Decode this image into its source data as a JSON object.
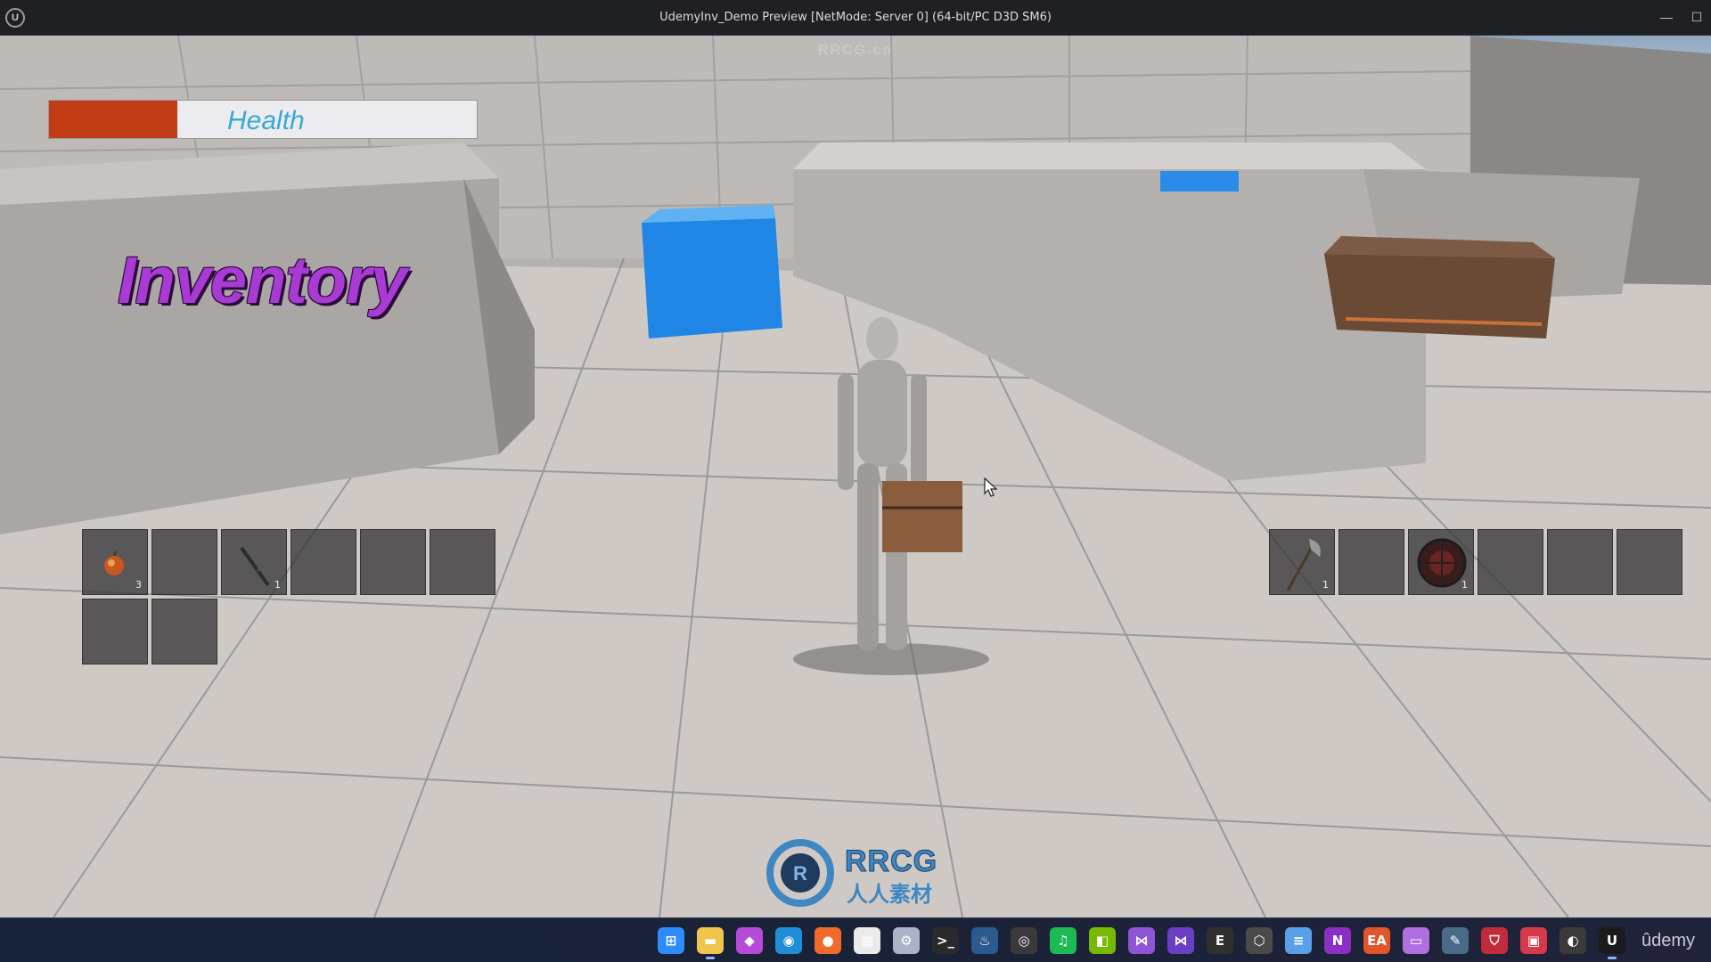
{
  "window": {
    "title": "UdemyInv_Demo Preview [NetMode: Server 0]  (64-bit/PC D3D SM6)",
    "app_icon_glyph": "U",
    "minimize_glyph": "—",
    "maximize_glyph": "☐"
  },
  "hud": {
    "health": {
      "label": "Health",
      "level": 0.3
    },
    "inventory_title": "Inventory"
  },
  "inventory_left": {
    "slots": [
      {
        "item": "apple-icon",
        "qty": "3"
      },
      {
        "item": "",
        "qty": ""
      },
      {
        "item": "sword-icon",
        "qty": "1"
      },
      {
        "item": "",
        "qty": ""
      },
      {
        "item": "",
        "qty": ""
      },
      {
        "item": "",
        "qty": ""
      },
      {
        "item": "",
        "qty": ""
      },
      {
        "item": "",
        "qty": ""
      }
    ]
  },
  "inventory_right": {
    "slots": [
      {
        "item": "axe-icon",
        "qty": "1"
      },
      {
        "item": "",
        "qty": ""
      },
      {
        "item": "shield-icon",
        "qty": "1"
      },
      {
        "item": "",
        "qty": ""
      },
      {
        "item": "",
        "qty": ""
      },
      {
        "item": "",
        "qty": ""
      }
    ]
  },
  "watermark": {
    "brand": "RRCG",
    "sub": "人人素材",
    "top_faint": "RRCG.cn"
  },
  "taskbar": {
    "icons": [
      {
        "name": "windows-start-icon",
        "glyph": "⊞",
        "color": "#2f8cff"
      },
      {
        "name": "file-explorer-icon",
        "glyph": "▬",
        "color": "#f1c44b"
      },
      {
        "name": "app-icon-1",
        "glyph": "◆",
        "color": "#b54bd8"
      },
      {
        "name": "edge-icon",
        "glyph": "◉",
        "color": "#1e8ed6"
      },
      {
        "name": "firefox-icon",
        "glyph": "●",
        "color": "#f06b2b"
      },
      {
        "name": "store-icon",
        "glyph": "▦",
        "color": "#eaeaea"
      },
      {
        "name": "settings-icon",
        "glyph": "⚙",
        "color": "#a9b4c8"
      },
      {
        "name": "terminal-icon",
        "glyph": ">_",
        "color": "#2a2a2a"
      },
      {
        "name": "steam-icon",
        "glyph": "♨",
        "color": "#2a5a8e"
      },
      {
        "name": "obs-icon",
        "glyph": "◎",
        "color": "#3a3a3a"
      },
      {
        "name": "spotify-icon",
        "glyph": "♫",
        "color": "#1db954"
      },
      {
        "name": "nvidia-icon",
        "glyph": "◧",
        "color": "#76b900"
      },
      {
        "name": "visual-studio-icon",
        "glyph": "⋈",
        "color": "#8e56d6"
      },
      {
        "name": "visual-studio-2-icon",
        "glyph": "⋈",
        "color": "#6a3fc4"
      },
      {
        "name": "epic-games-icon",
        "glyph": "E",
        "color": "#303030"
      },
      {
        "name": "unity-icon",
        "glyph": "⬡",
        "color": "#4a4a4a"
      },
      {
        "name": "notepad-icon",
        "glyph": "≡",
        "color": "#5aa0e8"
      },
      {
        "name": "onenote-icon",
        "glyph": "N",
        "color": "#8a2fc2"
      },
      {
        "name": "ea-icon",
        "glyph": "EA",
        "color": "#e2552b"
      },
      {
        "name": "folder-purple-icon",
        "glyph": "▭",
        "color": "#b06fe0"
      },
      {
        "name": "notes-icon",
        "glyph": "✎",
        "color": "#4a6a8a"
      },
      {
        "name": "shield-app-icon",
        "glyph": "⛉",
        "color": "#c42b3a"
      },
      {
        "name": "app-red-icon",
        "glyph": "▣",
        "color": "#d63a4a"
      },
      {
        "name": "github-icon",
        "glyph": "◐",
        "color": "#3a3a3a"
      },
      {
        "name": "unreal-engine-icon",
        "glyph": "U",
        "color": "#1b1b1b"
      }
    ],
    "udemy_label": "ûdemy"
  }
}
